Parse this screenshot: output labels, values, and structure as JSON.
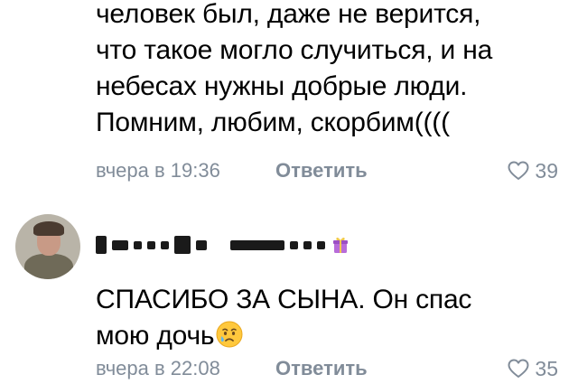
{
  "comments": [
    {
      "text_lines": [
        "человек был, даже не верится,",
        "что такое могло случиться, и на",
        "небесах нужны добрые люди.",
        "Помним, любим, скорбим(((("
      ],
      "time": "вчера в 19:36",
      "reply_label": "Ответить",
      "likes": "39"
    },
    {
      "author_name": "И... М... ....",
      "text_lines": [
        "СПАСИБО ЗА СЫНА. Он спас",
        "мою дочь"
      ],
      "time": "вчера в 22:08",
      "reply_label": "Ответить",
      "likes": "35"
    }
  ],
  "icons": {
    "like": "heart-outline-icon",
    "gift": "gift-icon",
    "emoji": "crying-face-emoji"
  },
  "colors": {
    "meta_text": "#818c99",
    "body_text": "#000000"
  }
}
